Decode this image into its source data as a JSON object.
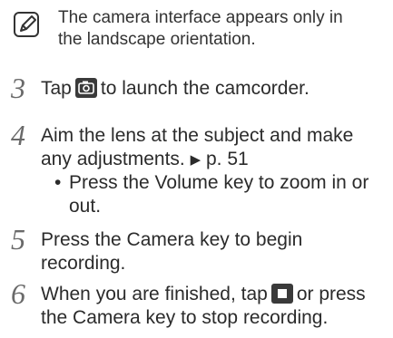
{
  "note": {
    "line1": "The camera interface appears only in",
    "line2": "the landscape orientation."
  },
  "steps": [
    {
      "num": "3",
      "before": "Tap",
      "after": "to launch the camcorder."
    },
    {
      "num": "4",
      "line1": "Aim the lens at the subject and make",
      "line2_text": "any adjustments.",
      "arrow": "▶",
      "ref": "p. 51",
      "bullet": "•",
      "bullet_line1": "Press the Volume key to zoom in or",
      "bullet_line2": "out."
    },
    {
      "num": "5",
      "line1": "Press the Camera key to begin",
      "line2": "recording."
    },
    {
      "num": "6",
      "line1_before": "When you are finished, tap",
      "line1_after": "or press",
      "line2": "the Camera key to stop recording."
    }
  ],
  "icons": {
    "note": "note-pencil-icon",
    "camera": "camera-switch-icon",
    "stop": "stop-icon"
  },
  "colors": {
    "text": "#2b2b2b",
    "number": "#6a6a6a",
    "icon_bg": "#3a3a3a"
  }
}
